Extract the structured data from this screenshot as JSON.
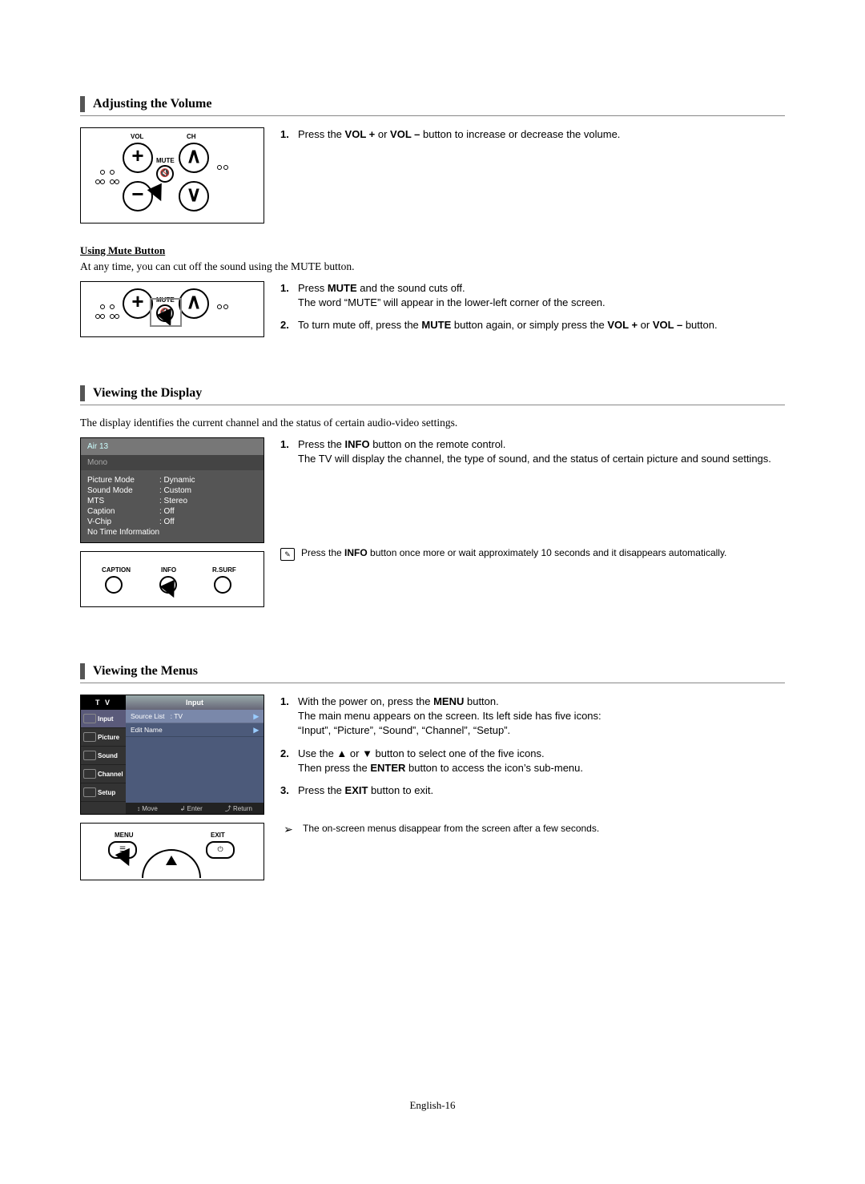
{
  "sections": {
    "adjust_vol": {
      "title": "Adjusting the Volume",
      "remote_labels": {
        "vol": "VOL",
        "ch": "CH",
        "mute": "MUTE"
      },
      "step1_pre": "Press the ",
      "step1_b1": "VOL +",
      "step1_mid": " or ",
      "step1_b2": "VOL –",
      "step1_post": " button to increase or decrease the volume."
    },
    "mute": {
      "title": "Using Mute Button",
      "intro": "At any time, you can cut off the sound using the MUTE button.",
      "remote_labels": {
        "mute": "MUTE"
      },
      "step1_pre": "Press ",
      "step1_b1": "MUTE",
      "step1_post": " and the sound cuts off.",
      "step1_line2": "The word “MUTE” will appear in the lower-left corner of the screen.",
      "step2_pre": "To turn mute off, press the ",
      "step2_b1": "MUTE",
      "step2_mid": " button again, or simply press the ",
      "step2_b2": "VOL +",
      "step2_mid2": " or ",
      "step2_b3": "VOL –",
      "step2_post": " button."
    },
    "display": {
      "title": "Viewing the Display",
      "intro": "The display identifies the current channel and the status of certain audio-video settings.",
      "osd": {
        "channel": "Air  13",
        "sound_mode_header": "Mono",
        "rows": [
          {
            "k": "Picture Mode",
            "v": ": Dynamic"
          },
          {
            "k": "Sound Mode",
            "v": ": Custom"
          },
          {
            "k": "MTS",
            "v": ": Stereo"
          },
          {
            "k": "Caption",
            "v": ": Off"
          },
          {
            "k": "V-Chip",
            "v": ": Off"
          }
        ],
        "last": "No Time Information"
      },
      "remote_labels": {
        "caption": "CAPTION",
        "info": "INFO",
        "rsurf": "R.SURF"
      },
      "step1_pre": "Press the ",
      "step1_b1": "INFO",
      "step1_post": " button on the remote control.",
      "step1_line2": "The TV will display the channel, the type of sound, and the status of certain picture and sound settings.",
      "note_pre": "Press the ",
      "note_b1": "INFO",
      "note_post": " button once more or wait approximately 10 seconds and it disappears automatically."
    },
    "menus": {
      "title": "Viewing the Menus",
      "osd": {
        "tv": "T V",
        "menu_title": "Input",
        "side": [
          "Input",
          "Picture",
          "Sound",
          "Channel",
          "Setup"
        ],
        "rows": [
          {
            "label": "Source List",
            "val": ": TV"
          },
          {
            "label": "Edit Name",
            "val": ""
          }
        ],
        "foot": {
          "move": "Move",
          "enter": "Enter",
          "ret": "Return",
          "move_sym": "↕",
          "enter_sym": "↲",
          "ret_sym": "⤴"
        }
      },
      "remote_labels": {
        "menu": "MENU",
        "exit": "EXIT"
      },
      "step1_pre": "With the power on, press the ",
      "step1_b1": "MENU",
      "step1_post": " button.",
      "step1_line2": "The main menu appears on the screen. Its left side has five icons:",
      "step1_line3": "“Input”, “Picture”, “Sound”, “Channel”, “Setup”.",
      "step2_pre": "Use the ▲ or ▼ button to select one of the five icons.",
      "step2_line2_pre": "Then press the ",
      "step2_line2_b1": "ENTER",
      "step2_line2_post": " button to access the icon’s sub-menu.",
      "step3_pre": "Press the ",
      "step3_b1": "EXIT",
      "step3_post": " button to exit.",
      "note": "The on-screen menus disappear from the screen after a few seconds.",
      "arrow": "➢"
    }
  },
  "nums": {
    "n1": "1.",
    "n2": "2.",
    "n3": "3."
  },
  "page_num": "English-16"
}
